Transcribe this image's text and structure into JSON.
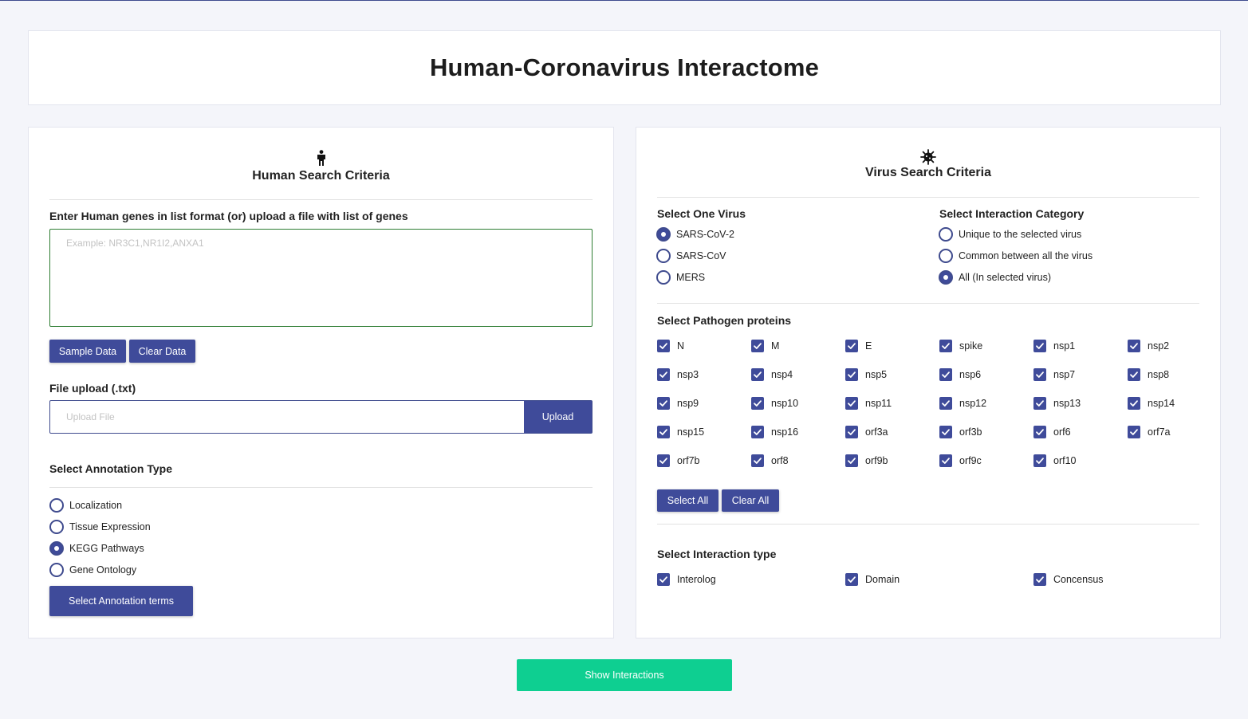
{
  "page": {
    "title": "Human-Coronavirus Interactome"
  },
  "human": {
    "heading": "Human Search Criteria",
    "icon": "person-icon",
    "genes_label": "Enter Human genes in list format (or) upload a file with list of genes",
    "genes_value": "",
    "genes_placeholder": "Example: NR3C1,NR1I2,ANXA1",
    "sample_data_label": "Sample Data",
    "clear_data_label": "Clear Data",
    "file_upload_label": "File upload (.txt)",
    "file_placeholder": "Upload File",
    "upload_label": "Upload",
    "annotation_label": "Select Annotation Type",
    "annotation_options": [
      {
        "label": "Localization",
        "checked": false
      },
      {
        "label": "Tissue Expression",
        "checked": false
      },
      {
        "label": "KEGG Pathways",
        "checked": true
      },
      {
        "label": "Gene Ontology",
        "checked": false
      }
    ],
    "annotation_terms_label": "Select Annotation terms"
  },
  "virus": {
    "heading": "Virus Search Criteria",
    "icon": "virus-icon",
    "select_virus_label": "Select One Virus",
    "viruses": [
      {
        "label": "SARS-CoV-2",
        "checked": true
      },
      {
        "label": "SARS-CoV",
        "checked": false
      },
      {
        "label": "MERS",
        "checked": false
      }
    ],
    "category_label": "Select Interaction Category",
    "categories": [
      {
        "label": "Unique to the selected virus",
        "checked": false
      },
      {
        "label": "Common between all the virus",
        "checked": false
      },
      {
        "label": "All (In selected virus)",
        "checked": true
      }
    ],
    "proteins_label": "Select Pathogen proteins",
    "proteins": [
      "N",
      "M",
      "E",
      "spike",
      "nsp1",
      "nsp2",
      "nsp3",
      "nsp4",
      "nsp5",
      "nsp6",
      "nsp7",
      "nsp8",
      "nsp9",
      "nsp10",
      "nsp11",
      "nsp12",
      "nsp13",
      "nsp14",
      "nsp15",
      "nsp16",
      "orf3a",
      "orf3b",
      "orf6",
      "orf7a",
      "orf7b",
      "orf8",
      "orf9b",
      "orf9c",
      "orf10"
    ],
    "select_all_label": "Select All",
    "clear_all_label": "Clear All",
    "interaction_type_label": "Select Interaction type",
    "interaction_types": [
      {
        "label": "Interolog",
        "checked": true
      },
      {
        "label": "Domain",
        "checked": true
      },
      {
        "label": "Concensus",
        "checked": true
      }
    ]
  },
  "show_interactions_label": "Show Interactions",
  "colors": {
    "primary": "#3f4b9a",
    "accent": "#0ecf91",
    "textarea_border": "#2e7d32"
  }
}
